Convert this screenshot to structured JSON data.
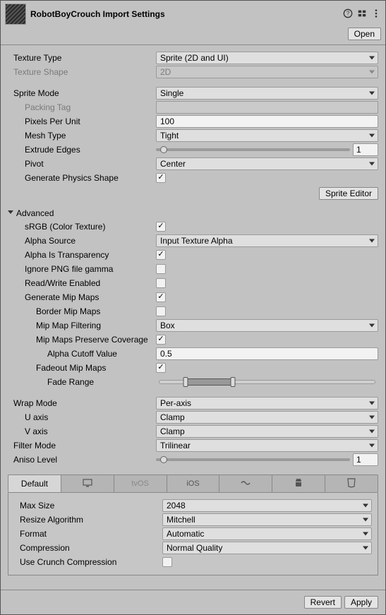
{
  "header": {
    "title": "RobotBoyCrouch Import Settings",
    "open_label": "Open"
  },
  "textureType": {
    "label": "Texture Type",
    "value": "Sprite (2D and UI)"
  },
  "textureShape": {
    "label": "Texture Shape",
    "value": "2D"
  },
  "spriteMode": {
    "label": "Sprite Mode",
    "value": "Single"
  },
  "packingTag": {
    "label": "Packing Tag",
    "value": ""
  },
  "pixelsPerUnit": {
    "label": "Pixels Per Unit",
    "value": "100"
  },
  "meshType": {
    "label": "Mesh Type",
    "value": "Tight"
  },
  "extrudeEdges": {
    "label": "Extrude Edges",
    "value": "1"
  },
  "pivot": {
    "label": "Pivot",
    "value": "Center"
  },
  "genPhysics": {
    "label": "Generate Physics Shape",
    "checked": true
  },
  "spriteEditorBtn": "Sprite Editor",
  "advanced": {
    "title": "Advanced",
    "srgb": {
      "label": "sRGB (Color Texture)",
      "checked": true
    },
    "alphaSource": {
      "label": "Alpha Source",
      "value": "Input Texture Alpha"
    },
    "alphaIsTransparency": {
      "label": "Alpha Is Transparency",
      "checked": true
    },
    "ignoreGamma": {
      "label": "Ignore PNG file gamma",
      "checked": false
    },
    "readWrite": {
      "label": "Read/Write Enabled",
      "checked": false
    },
    "genMipMaps": {
      "label": "Generate Mip Maps",
      "checked": true
    },
    "borderMip": {
      "label": "Border Mip Maps",
      "checked": false
    },
    "mipFilter": {
      "label": "Mip Map Filtering",
      "value": "Box"
    },
    "preserveCoverage": {
      "label": "Mip Maps Preserve Coverage",
      "checked": true
    },
    "alphaCutoff": {
      "label": "Alpha Cutoff Value",
      "value": "0.5"
    },
    "fadeoutMip": {
      "label": "Fadeout Mip Maps",
      "checked": true
    },
    "fadeRange": {
      "label": "Fade Range"
    }
  },
  "wrapMode": {
    "label": "Wrap Mode",
    "value": "Per-axis"
  },
  "uAxis": {
    "label": "U axis",
    "value": "Clamp"
  },
  "vAxis": {
    "label": "V axis",
    "value": "Clamp"
  },
  "filterMode": {
    "label": "Filter Mode",
    "value": "Trilinear"
  },
  "anisoLevel": {
    "label": "Aniso Level",
    "value": "1"
  },
  "platforms": {
    "default": "Default",
    "tvos": "tvOS",
    "ios": "iOS"
  },
  "maxSize": {
    "label": "Max Size",
    "value": "2048"
  },
  "resizeAlgo": {
    "label": "Resize Algorithm",
    "value": "Mitchell"
  },
  "format": {
    "label": "Format",
    "value": "Automatic"
  },
  "compression": {
    "label": "Compression",
    "value": "Normal Quality"
  },
  "useCrunch": {
    "label": "Use Crunch Compression",
    "checked": false
  },
  "footer": {
    "revert": "Revert",
    "apply": "Apply"
  }
}
